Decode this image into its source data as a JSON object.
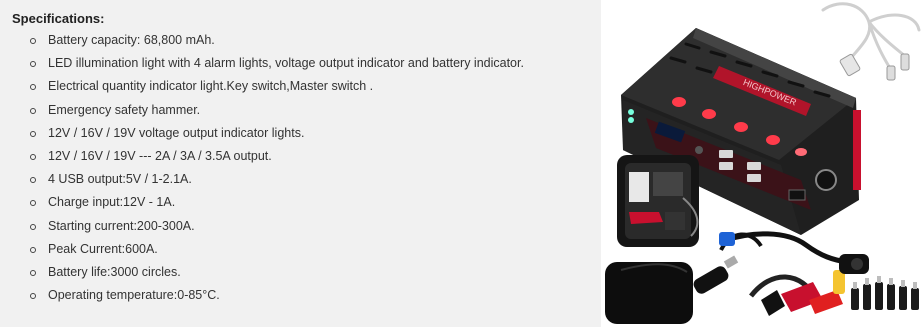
{
  "specs": {
    "title": "Specifications:",
    "items": [
      "Battery capacity: 68,800 mAh.",
      "LED illumination light with 4 alarm lights, voltage output indicator and battery indicator.",
      "Electrical quantity indicator light.Key switch,Master switch .",
      "Emergency safety hammer.",
      "12V / 16V / 19V voltage output indicator lights.",
      "12V / 16V / 19V --- 2A / 3A / 3.5A output.",
      "4 USB output:5V / 1-2.1A.",
      "Charge input:12V - 1A.",
      "Starting current:200-300A.",
      "Peak Current:600A.",
      "Battery life:3000 circles.",
      "Operating temperature:0-85°C."
    ]
  },
  "product": {
    "device_label": "HIGHPOWER",
    "colors": {
      "body": "#2a2a2a",
      "accent": "#c8102e",
      "panel": "#3a3a3a",
      "led": "#ff3b4a"
    }
  }
}
